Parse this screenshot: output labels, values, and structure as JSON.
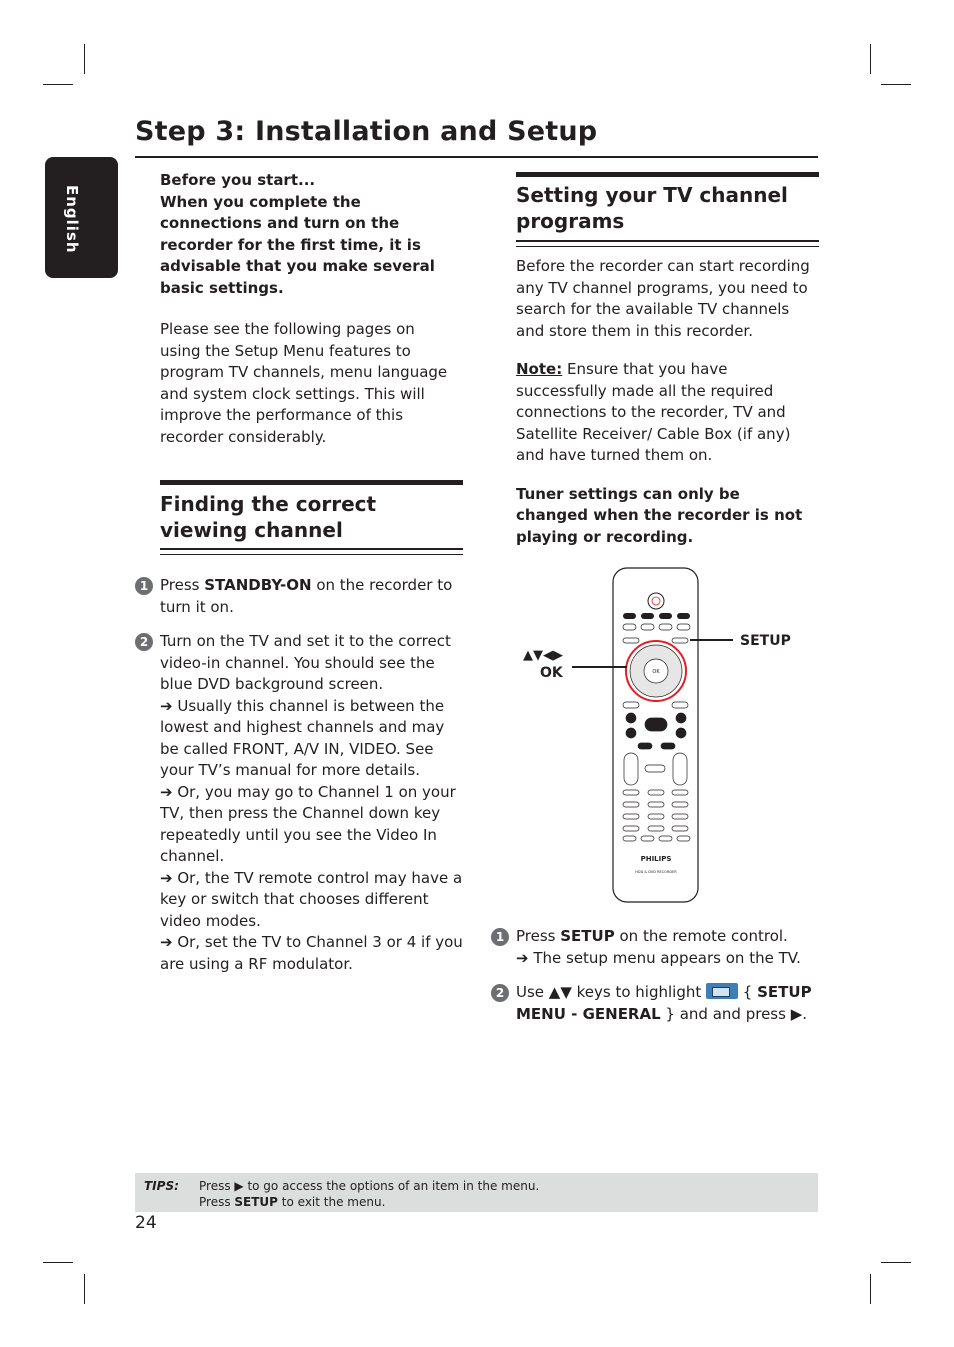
{
  "header": {
    "title": "Step 3: Installation and Setup",
    "language_tab": "English"
  },
  "left": {
    "intro": [
      [
        {
          "t": "Before you start...",
          "b": true
        }
      ],
      [
        {
          "t": "When you complete the connections and turn on the recorder for the first time, it is advisable that you make several basic settings.",
          "b": true
        }
      ]
    ],
    "intro_body": [
      {
        "t": "Please see the following pages on using the Setup Menu features to program TV channels, menu language and system clock settings. This will improve the performance of this recorder considerably."
      }
    ],
    "section_title": "Finding the correct viewing channel",
    "steps": [
      {
        "num": "1",
        "paras": [
          [
            {
              "t": "Press "
            },
            {
              "t": "STANDBY-ON",
              "b": true
            },
            {
              "t": " on the recorder to turn it on."
            }
          ]
        ]
      },
      {
        "num": "2",
        "paras": [
          [
            {
              "t": "Turn on the TV and set it to the correct video-in channel. You should see the blue DVD background screen."
            }
          ],
          [
            {
              "t": "➔ Usually this channel is between the lowest and highest channels and may be called FRONT, A/V IN, VIDEO. See your TV’s manual for more details."
            }
          ],
          [
            {
              "t": "➔ Or, you may go to Channel 1 on your TV, then press the Channel down key repeatedly until you see the Video In channel."
            }
          ],
          [
            {
              "t": "➔ Or, the TV remote control may have a key or switch that chooses different video modes."
            }
          ],
          [
            {
              "t": "➔ Or, set the TV to Channel 3 or 4 if you are using a RF modulator."
            }
          ]
        ]
      }
    ]
  },
  "right": {
    "section_title": "Setting your TV channel programs",
    "intro": [
      {
        "t": "Before the recorder can start recording any TV channel programs, you need to search for the available TV channels and store them in this recorder."
      }
    ],
    "note": [
      {
        "t": "Note:",
        "u": true
      },
      {
        "t": " Ensure that you have successfully made all the required connections to the recorder, TV and Satellite Receiver/ Cable Box (if any) and have turned them on."
      }
    ],
    "warning": [
      {
        "t": "Tuner settings can only be changed when the recorder is not playing or recording.",
        "b": true
      }
    ],
    "remote": {
      "callout_keys": "▲▼◀▶",
      "callout_ok": "OK",
      "callout_setup": "SETUP",
      "brand": "PHILIPS",
      "model": "HDD & DVD RECORDER",
      "ok_key": "OK",
      "accent_color": "#e31e24"
    },
    "steps": [
      {
        "num": "1",
        "paras": [
          [
            {
              "t": "Press "
            },
            {
              "t": "SETUP",
              "b": true
            },
            {
              "t": " on the remote control."
            }
          ],
          [
            {
              "t": "➔ The setup menu appears on the TV."
            }
          ]
        ]
      },
      {
        "num": "2",
        "paras": [
          [
            {
              "t": "Use ▲▼ keys to highlight "
            },
            {
              "icon": "setup-general-icon"
            },
            {
              "t": " { "
            },
            {
              "t": "SETUP MENU - GENERAL",
              "b": true
            },
            {
              "t": " } and and press ▶."
            }
          ]
        ]
      }
    ]
  },
  "tips": {
    "label": "TIPS:",
    "line1": [
      {
        "t": "Press ▶ to go access the options of an item in the menu."
      }
    ],
    "line2": [
      {
        "t": "Press "
      },
      {
        "t": "SETUP",
        "b": true
      },
      {
        "t": " to exit the menu."
      }
    ]
  },
  "page_number": "24"
}
